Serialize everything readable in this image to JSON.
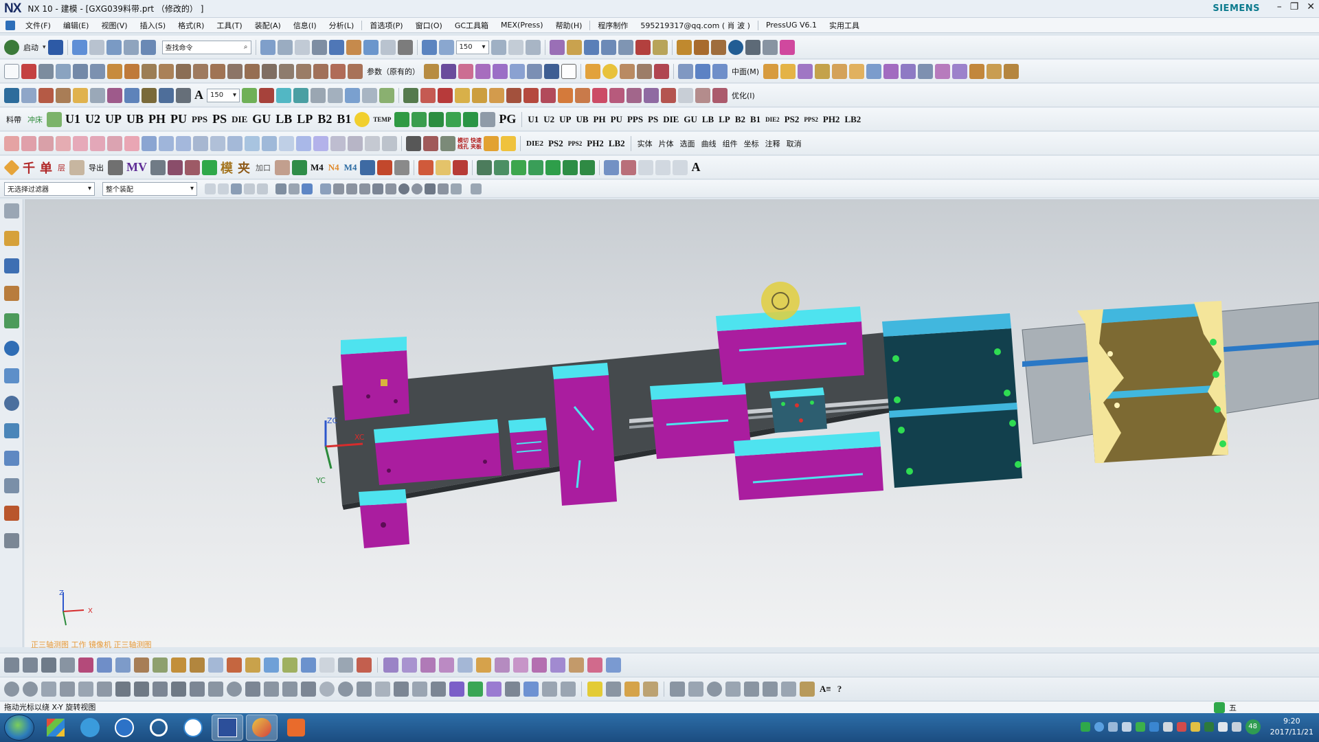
{
  "window": {
    "logo": "NX",
    "title": "NX 10 - 建模 - [GXG039料带.prt （修改的） ]",
    "brand": "SIEMENS",
    "controls": [
      "–",
      "❐",
      "✕"
    ]
  },
  "menubar": {
    "items": [
      "文件(F)",
      "编辑(E)",
      "视图(V)",
      "插入(S)",
      "格式(R)",
      "工具(T)",
      "装配(A)",
      "信息(I)",
      "分析(L)",
      "首选项(P)",
      "窗口(O)",
      "GC工具箱",
      "MEX(Press)",
      "帮助(H)",
      "程序制作",
      "595219317@qq.com ( 肖 波 )",
      "PressUG V6.1",
      "实用工具"
    ],
    "subwindow_controls": [
      "–",
      "❐",
      "✕"
    ]
  },
  "toolbar1": {
    "start_label": "启动",
    "search_placeholder": "查找命令",
    "zoom_value": "150"
  },
  "toolbar2": {
    "param_label": "参数（原有的）",
    "center_label": "中面(M)"
  },
  "toolbar3": {
    "font_size": "150",
    "optimize_label": "优化(I)"
  },
  "toolbar4": {
    "items": [
      "料帶",
      "冲床",
      "U1",
      "U2",
      "UP",
      "UB",
      "PH",
      "PU",
      "PPS",
      "PS",
      "DIE",
      "GU",
      "LB",
      "LP",
      "B2",
      "B1",
      "TEMP",
      "PG"
    ],
    "small_items": [
      "U1",
      "U2",
      "UP",
      "UB",
      "PH",
      "PU",
      "PPS",
      "PS",
      "DIE",
      "GU",
      "LB",
      "LP",
      "B2",
      "B1",
      "DIE2",
      "PS2",
      "PPS2",
      "PH2",
      "LB2"
    ]
  },
  "toolbar5": {
    "items": [
      "DIE2",
      "PS2",
      "PPS2",
      "PH2",
      "LB2"
    ],
    "text_items": [
      "实体",
      "片体",
      "选面",
      "曲线",
      "组件",
      "坐标",
      "注释",
      "取消"
    ]
  },
  "toolbar6": {
    "items": [
      "千",
      "单",
      "层",
      "导出",
      "MV",
      "模",
      "夹",
      "加口",
      "M4",
      "N4",
      "M4"
    ]
  },
  "selection_bar": {
    "filter_value": "无选择过滤器",
    "scope_value": "整个装配"
  },
  "viewport": {
    "triad_labels": [
      "ZC",
      "XC",
      "YC"
    ],
    "corner_triad": [
      "Z",
      "X"
    ],
    "status_message": "正三轴测图 工作 镜像机 正三轴测图"
  },
  "prompt_line": "拖动光标以绕 X-Y 旋转视图",
  "taskbar": {
    "clock_time": "9:20",
    "clock_date": "2017/11/21",
    "tray_badge": "48",
    "ime_label": "五"
  },
  "colors": {
    "strip_plate": "#454a4d",
    "insert_magenta": "#aa1d9f",
    "insert_cyan": "#4ee3ef",
    "die_block": "#12404d",
    "guide_yellow": "#f4e59a",
    "guide_olive": "#7d6a33",
    "hole_green": "#2fdc52"
  }
}
